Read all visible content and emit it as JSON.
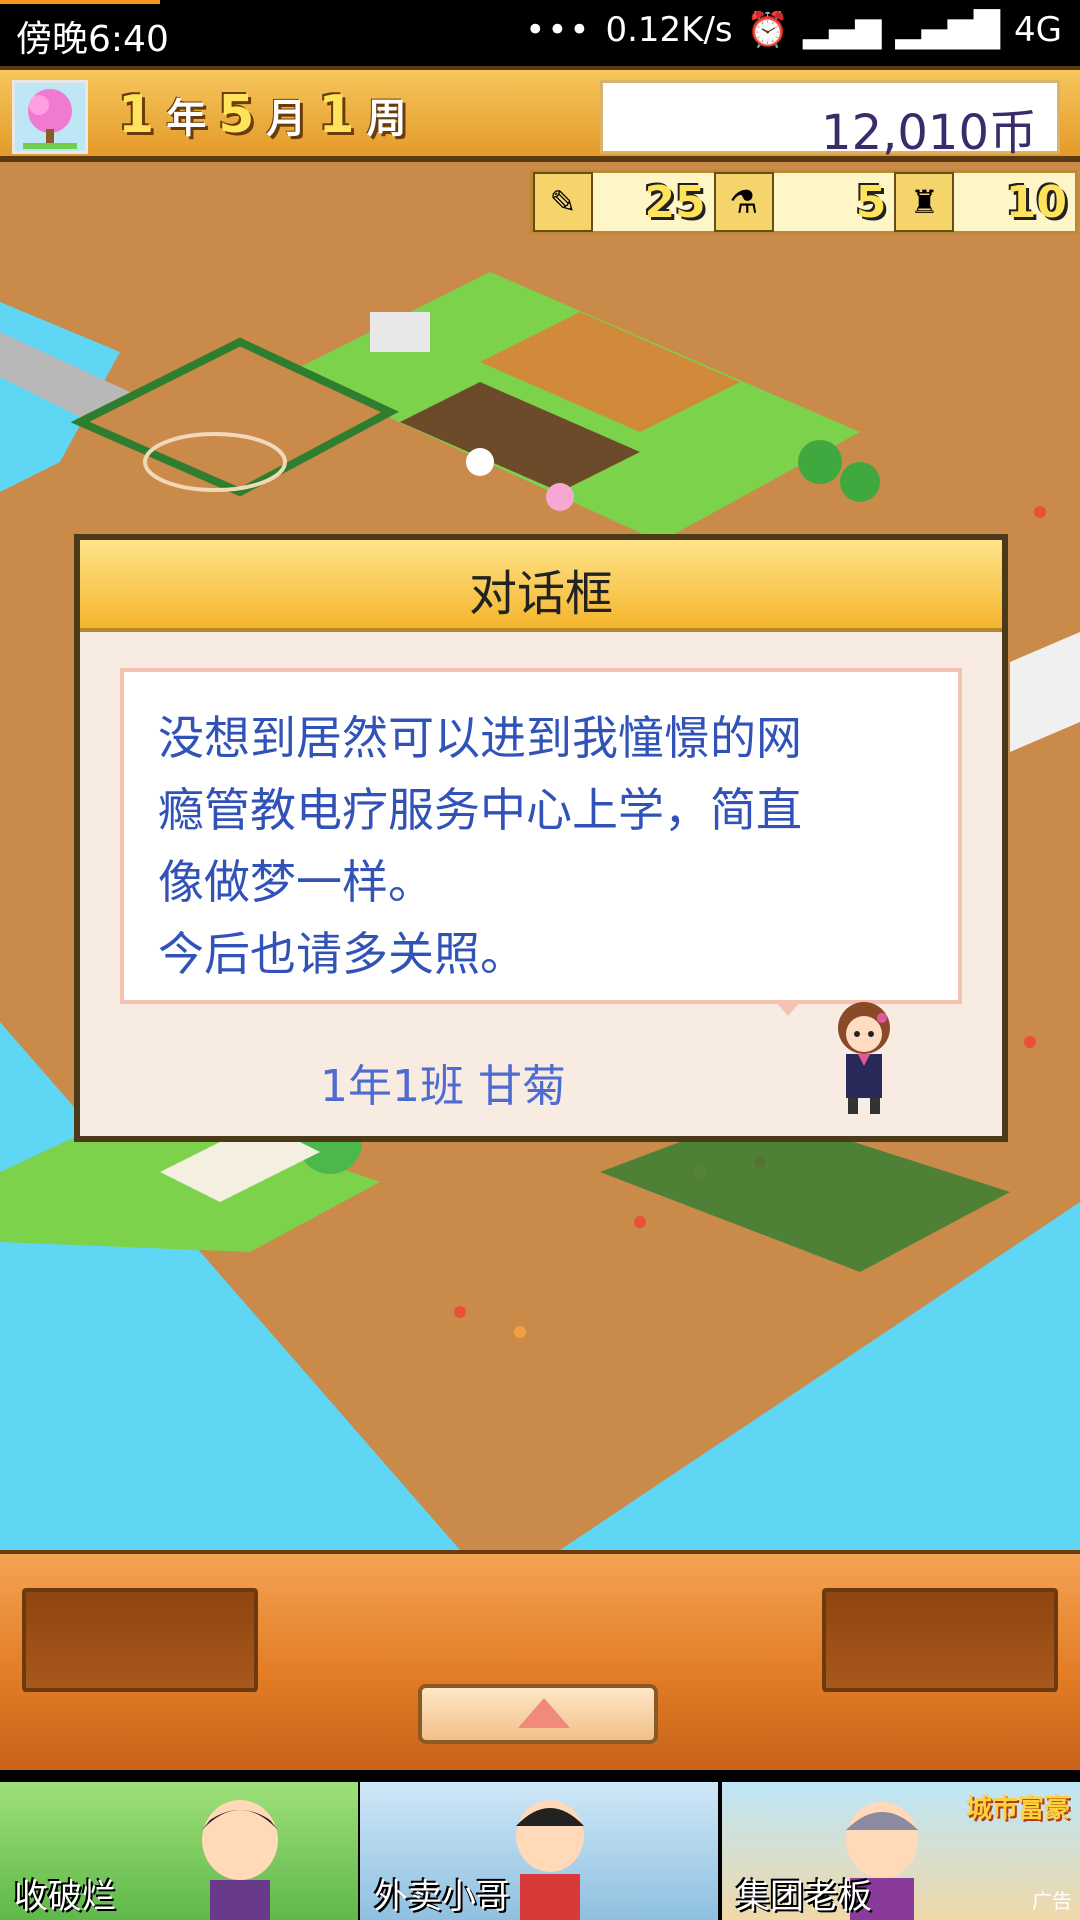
{
  "status": {
    "time": "傍晚6:40",
    "speed": "0.12K/s",
    "network": "4G",
    "dots": "•••"
  },
  "top": {
    "year": "1",
    "year_unit": "年",
    "month": "5",
    "month_unit": "月",
    "week": "1",
    "week_unit": "周",
    "money": "12,010币"
  },
  "resources": [
    {
      "icon": "pencil-icon",
      "value": "25"
    },
    {
      "icon": "flask-icon",
      "value": "5"
    },
    {
      "icon": "trophy-icon",
      "value": "10"
    }
  ],
  "dialog": {
    "title": "对话框",
    "lines": [
      "没想到居然可以进到我憧憬的网",
      "瘾管教电疗服务中心上学，简直",
      "像做梦一样。",
      "今后也请多关照。"
    ],
    "speaker": "1年1班 甘菊"
  },
  "ads": [
    {
      "label": "收破烂"
    },
    {
      "label": "外卖小哥"
    },
    {
      "label": "集团老板",
      "tag": "广告",
      "badge": "城市富豪"
    }
  ],
  "colors": {
    "accent": "#f4b52c",
    "text_blue": "#3153b8",
    "sea": "#5fd6f4",
    "ground": "#c98a4a",
    "grass": "#7cd24a"
  }
}
